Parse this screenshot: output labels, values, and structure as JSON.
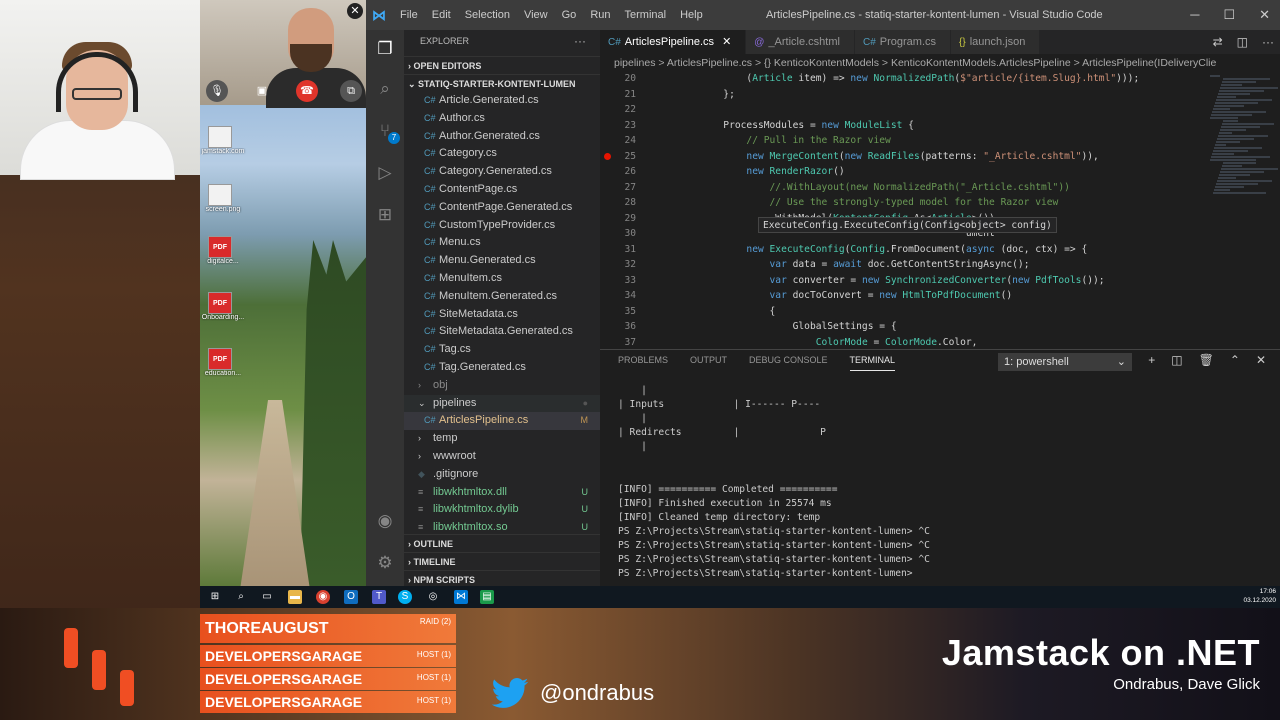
{
  "vscode": {
    "menu": [
      "File",
      "Edit",
      "Selection",
      "View",
      "Go",
      "Run",
      "Terminal",
      "Help"
    ],
    "window_title": "ArticlesPipeline.cs - statiq-starter-kontent-lumen - Visual Studio Code",
    "explorer_label": "EXPLORER",
    "open_editors_label": "OPEN EDITORS",
    "project_label": "STATIQ-STARTER-KONTENT-LUMEN",
    "tree": [
      {
        "label": "Article.Generated.cs",
        "type": "cs"
      },
      {
        "label": "Author.cs",
        "type": "cs"
      },
      {
        "label": "Author.Generated.cs",
        "type": "cs"
      },
      {
        "label": "Category.cs",
        "type": "cs"
      },
      {
        "label": "Category.Generated.cs",
        "type": "cs"
      },
      {
        "label": "ContentPage.cs",
        "type": "cs"
      },
      {
        "label": "ContentPage.Generated.cs",
        "type": "cs"
      },
      {
        "label": "CustomTypeProvider.cs",
        "type": "cs"
      },
      {
        "label": "Menu.cs",
        "type": "cs"
      },
      {
        "label": "Menu.Generated.cs",
        "type": "cs"
      },
      {
        "label": "MenuItem.cs",
        "type": "cs"
      },
      {
        "label": "MenuItem.Generated.cs",
        "type": "cs"
      },
      {
        "label": "SiteMetadata.cs",
        "type": "cs"
      },
      {
        "label": "SiteMetadata.Generated.cs",
        "type": "cs"
      },
      {
        "label": "Tag.cs",
        "type": "cs"
      },
      {
        "label": "Tag.Generated.cs",
        "type": "cs"
      },
      {
        "label": "obj",
        "type": "folder"
      },
      {
        "label": "pipelines",
        "type": "folder-open"
      },
      {
        "label": "ArticlesPipeline.cs",
        "type": "cs",
        "mark": "M"
      },
      {
        "label": "temp",
        "type": "folder"
      },
      {
        "label": "wwwroot",
        "type": "folder"
      },
      {
        "label": ".gitignore",
        "type": "file"
      },
      {
        "label": "libwkhtmltox.dll",
        "type": "lib",
        "mark": "U"
      },
      {
        "label": "libwkhtmltox.dylib",
        "type": "lib",
        "mark": "U"
      },
      {
        "label": "libwkhtmltox.so",
        "type": "lib",
        "mark": "U"
      }
    ],
    "sections": [
      "OUTLINE",
      "TIMELINE",
      "NPM SCRIPTS"
    ],
    "tabs": [
      {
        "label": "ArticlesPipeline.cs",
        "active": true
      },
      {
        "label": "_Article.cshtml",
        "active": false
      },
      {
        "label": "Program.cs",
        "active": false
      },
      {
        "label": "launch.json",
        "active": false
      }
    ],
    "breadcrumb": "pipelines  >  ArticlesPipeline.cs  >  {} KenticoKontentModels  >  KenticoKontentModels.ArticlesPipeline  >  ArticlesPipeline(IDeliveryClie",
    "code_lines": [
      {
        "n": "20",
        "text": "                (Article item) => new NormalizedPath($\"article/{item.Slug}.html\")));"
      },
      {
        "n": "21",
        "text": "            };"
      },
      {
        "n": "22",
        "text": ""
      },
      {
        "n": "23",
        "text": "            ProcessModules = new ModuleList {"
      },
      {
        "n": "24",
        "text": "                // Pull in the Razor view"
      },
      {
        "n": "25",
        "text": "                new MergeContent(new ReadFiles(patterns: \"_Article.cshtml\")),"
      },
      {
        "n": "26",
        "text": "                new RenderRazor()"
      },
      {
        "n": "27",
        "text": "                    //.WithLayout(new NormalizedPath(\"_Article.cshtml\"))"
      },
      {
        "n": "28",
        "text": "                    // Use the strongly-typed model for the Razor view"
      },
      {
        "n": "29",
        "text": "                    .WithModel(KontentConfig.As<Article>()),"
      },
      {
        "n": "30",
        "text": "                                                      ument"
      },
      {
        "n": "31",
        "text": "                new ExecuteConfig(Config.FromDocument(async (doc, ctx) => {"
      },
      {
        "n": "32",
        "text": "                    var data = await doc.GetContentStringAsync();"
      },
      {
        "n": "33",
        "text": "                    var converter = new SynchronizedConverter(new PdfTools());"
      },
      {
        "n": "34",
        "text": "                    var docToConvert = new HtmlToPdfDocument()"
      },
      {
        "n": "35",
        "text": "                    {"
      },
      {
        "n": "36",
        "text": "                        GlobalSettings = {"
      },
      {
        "n": "37",
        "text": "                            ColorMode = ColorMode.Color,"
      }
    ],
    "hover_tip": "ExecuteConfig.ExecuteConfig(Config<object> config)",
    "panel_tabs": [
      "PROBLEMS",
      "OUTPUT",
      "DEBUG CONSOLE",
      "TERMINAL"
    ],
    "terminal_select": "1: powershell",
    "terminal_lines": [
      "    |",
      "| Inputs            | I------ P----",
      "    |",
      "| Redirects         |              P",
      "    |",
      "",
      "",
      "[INFO] ========== Completed ==========",
      "[INFO] Finished execution in 25574 ms",
      "[INFO] Cleaned temp directory: temp",
      "PS Z:\\Projects\\Stream\\statiq-starter-kontent-lumen> ^C",
      "PS Z:\\Projects\\Stream\\statiq-starter-kontent-lumen> ^C",
      "PS Z:\\Projects\\Stream\\statiq-starter-kontent-lumen> ^C",
      "PS Z:\\Projects\\Stream\\statiq-starter-kontent-lumen> "
    ]
  },
  "desktop_icons": [
    {
      "label": "jamstack.com",
      "kind": "png"
    },
    {
      "label": "screen.png",
      "kind": "png"
    },
    {
      "label": "digitalce...",
      "kind": "pdf"
    },
    {
      "label": "Onboarding...",
      "kind": "pdf"
    },
    {
      "label": "education...",
      "kind": "pdf"
    }
  ],
  "clock": {
    "time": "17:06",
    "date": "03.12.2020"
  },
  "overlay": {
    "participants": [
      {
        "name": "THOREAUGUST",
        "role": "RAID (2)"
      },
      {
        "name": "DEVELOPERSGARAGE",
        "role": "HOST (1)"
      },
      {
        "name": "DEVELOPERSGARAGE",
        "role": "HOST (1)"
      },
      {
        "name": "DEVELOPERSGARAGE",
        "role": "HOST (1)"
      }
    ],
    "twitter_handle": "@ondrabus",
    "show_title": "Jamstack on .NET",
    "show_subtitle": "Ondrabus, Dave Glick"
  },
  "colors": {
    "brand": "#f04e23",
    "vscode_accent": "#007acc",
    "twitter": "#1da1f2"
  }
}
